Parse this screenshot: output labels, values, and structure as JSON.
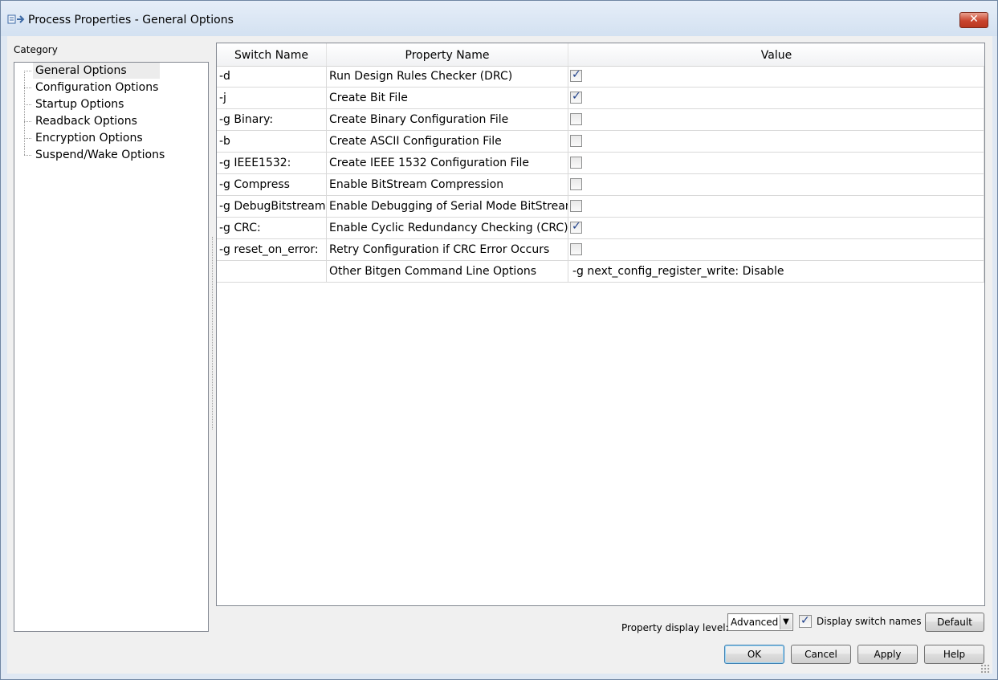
{
  "window": {
    "title": "Process Properties - General Options",
    "close_label": "✕"
  },
  "category": {
    "label": "Category",
    "items": [
      {
        "label": "General Options",
        "selected": true
      },
      {
        "label": "Configuration Options",
        "selected": false
      },
      {
        "label": "Startup Options",
        "selected": false
      },
      {
        "label": "Readback Options",
        "selected": false
      },
      {
        "label": "Encryption Options",
        "selected": false
      },
      {
        "label": "Suspend/Wake Options",
        "selected": false
      }
    ]
  },
  "table": {
    "headers": [
      "Switch Name",
      "Property Name",
      "Value"
    ],
    "rows": [
      {
        "switch": "-d",
        "property": "Run Design Rules Checker (DRC)",
        "type": "checkbox",
        "checked": true
      },
      {
        "switch": "-j",
        "property": "Create Bit File",
        "type": "checkbox",
        "checked": true
      },
      {
        "switch": "-g Binary:",
        "property": "Create Binary Configuration File",
        "type": "checkbox",
        "checked": false
      },
      {
        "switch": "-b",
        "property": "Create ASCII Configuration File",
        "type": "checkbox",
        "checked": false
      },
      {
        "switch": "-g IEEE1532:",
        "property": "Create IEEE 1532 Configuration File",
        "type": "checkbox",
        "checked": false
      },
      {
        "switch": "-g Compress",
        "property": "Enable BitStream Compression",
        "type": "checkbox",
        "checked": false
      },
      {
        "switch": "-g DebugBitstream:",
        "property": "Enable Debugging of Serial Mode BitStream",
        "type": "checkbox",
        "checked": false
      },
      {
        "switch": "-g CRC:",
        "property": "Enable Cyclic Redundancy Checking (CRC)",
        "type": "checkbox",
        "checked": true
      },
      {
        "switch": "-g reset_on_error:",
        "property": "Retry Configuration if CRC Error Occurs",
        "type": "checkbox",
        "checked": false
      },
      {
        "switch": "",
        "property": "Other Bitgen Command Line Options",
        "type": "text",
        "value": "-g next_config_register_write: Disable"
      }
    ]
  },
  "footer": {
    "display_level_label": "Property display level:",
    "display_level_value": "Advanced",
    "display_switch_names_label": "Display switch names",
    "display_switch_names_checked": true,
    "default_label": "Default",
    "ok_label": "OK",
    "cancel_label": "Cancel",
    "apply_label": "Apply",
    "help_label": "Help"
  },
  "colors": {
    "check_mark": "#1d3f8a",
    "close_button": "#c9452e",
    "selection": "#ececec"
  }
}
